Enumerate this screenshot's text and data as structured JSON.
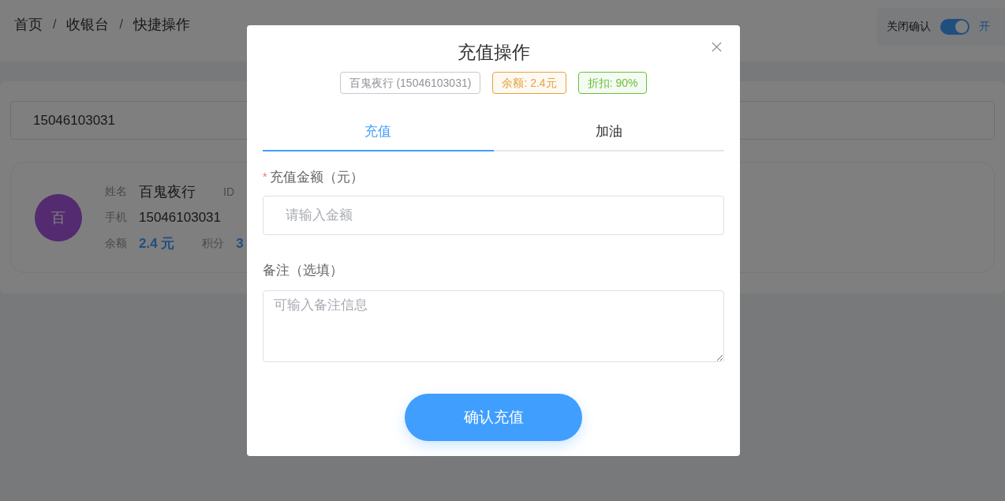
{
  "breadcrumb": {
    "separator": "/",
    "items": [
      "首页",
      "收银台",
      "快捷操作"
    ]
  },
  "confirm_toggle": {
    "label": "关闭确认",
    "on": true,
    "state_text": "开"
  },
  "search": {
    "value": "15046103031"
  },
  "member": {
    "avatar": "百",
    "rows": [
      [
        {
          "label": "姓名",
          "value": "百鬼夜行",
          "kind": "name"
        },
        {
          "label": "ID"
        }
      ],
      [
        {
          "label": "手机",
          "value": "15046103031"
        }
      ],
      [
        {
          "label": "余额",
          "value": "2.4 元",
          "kind": "amount"
        },
        {
          "label": "积分",
          "value": "3",
          "kind": "amount"
        }
      ]
    ]
  },
  "dialog": {
    "title": "充值操作",
    "tags": [
      {
        "text": "百鬼夜行 (15046103031)",
        "color": "#909399"
      },
      {
        "text": "余额: 2.4元",
        "color": "#e6a23c"
      },
      {
        "text": "折扣: 90%",
        "color": "#67c23a"
      }
    ],
    "tabs": [
      {
        "label": "充值",
        "selected": true
      },
      {
        "label": "加油",
        "selected": false
      }
    ],
    "amount": {
      "label": "充值金额（元）",
      "required_mark": "*",
      "placeholder": "请输入金额"
    },
    "note": {
      "label": "备注（选填）",
      "placeholder": "可输入备注信息"
    },
    "submit": "确认充值"
  }
}
